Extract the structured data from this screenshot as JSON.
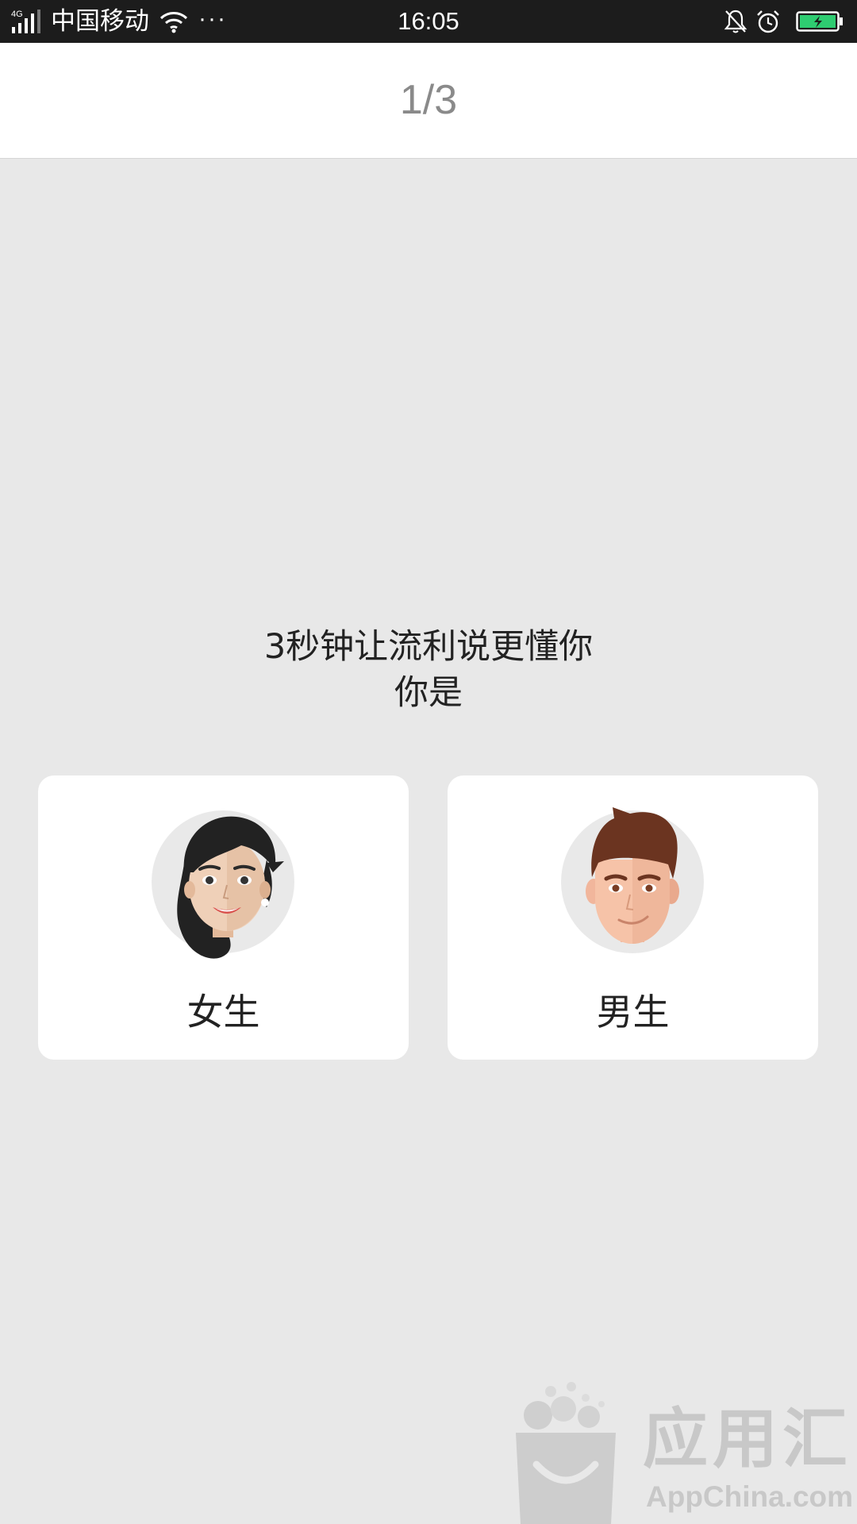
{
  "status_bar": {
    "network": "4G",
    "carrier": "中国移动",
    "more": "···",
    "time": "16:05",
    "icons": [
      "signal-icon",
      "wifi-icon",
      "bell-muted-icon",
      "alarm-icon",
      "battery-charging-icon"
    ],
    "battery_color": "#2ecc71"
  },
  "header": {
    "step": "1/3"
  },
  "prompt": {
    "line1": "3秒钟让流利说更懂你",
    "line2": "你是"
  },
  "options": [
    {
      "label": "女生",
      "icon": "female-avatar-icon"
    },
    {
      "label": "男生",
      "icon": "male-avatar-icon"
    }
  ],
  "watermark": {
    "title": "应用汇",
    "site": "AppChina.com"
  },
  "colors": {
    "background": "#e8e8e8",
    "card": "#ffffff",
    "status_bar": "#1c1c1c",
    "step_text": "#8a8a8a"
  }
}
